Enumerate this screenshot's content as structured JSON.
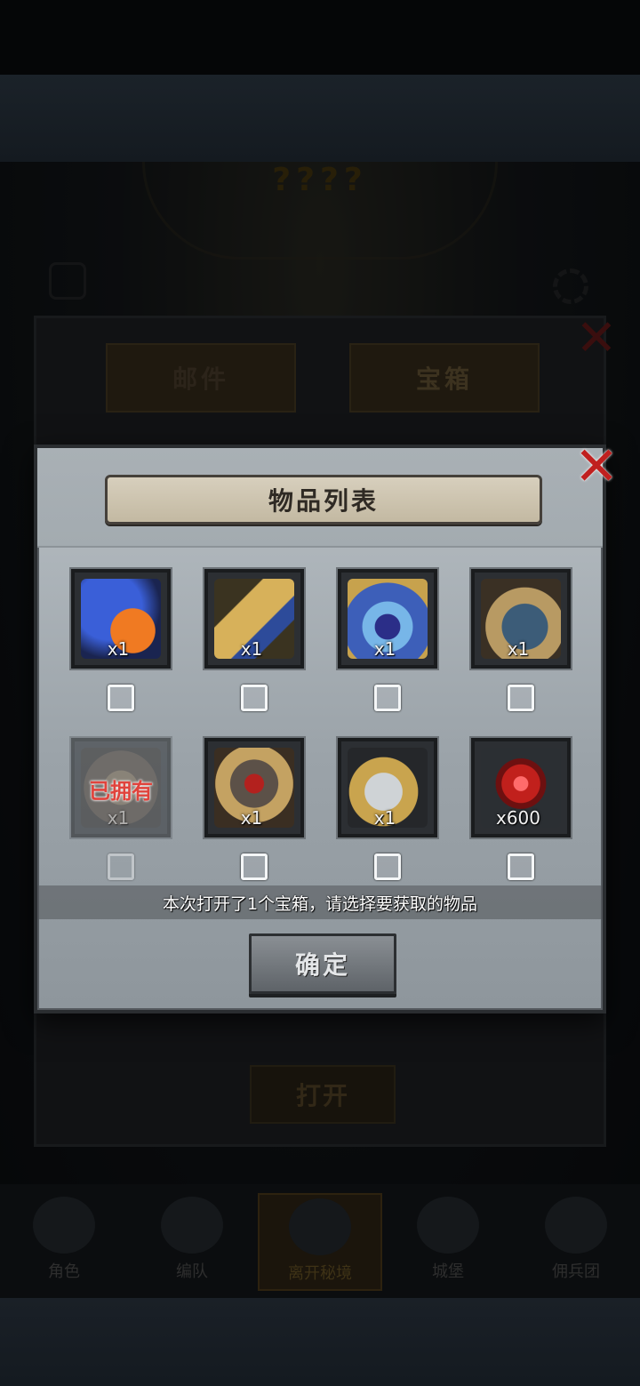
{
  "background": {
    "title_placeholder": "????",
    "mail_panel": {
      "tabs": [
        "邮件",
        "宝箱"
      ],
      "close_symbol": "✕",
      "open_button": "打开"
    },
    "nav": [
      "角色",
      "编队",
      "离开秘境",
      "城堡",
      "佣兵团"
    ]
  },
  "dialog": {
    "title": "物品列表",
    "close_symbol": "✕",
    "items": [
      {
        "icon": "flame-swirl-gem-icon",
        "qty": "x1",
        "owned": false
      },
      {
        "icon": "golden-shield-icon",
        "qty": "x1",
        "owned": false
      },
      {
        "icon": "crystal-tome-icon",
        "qty": "x1",
        "owned": false
      },
      {
        "icon": "winged-shield-icon",
        "qty": "x1",
        "owned": false
      },
      {
        "icon": "rune-disc-icon",
        "qty": "x1",
        "owned": true,
        "owned_label": "已拥有"
      },
      {
        "icon": "armored-knight-card-icon",
        "qty": "x1",
        "owned": false
      },
      {
        "icon": "moon-crest-shield-icon",
        "qty": "x1",
        "owned": false
      },
      {
        "icon": "red-crystal-icon",
        "qty": "x600",
        "owned": false
      }
    ],
    "notice": "本次打开了1个宝箱，请选择要获取的物品",
    "confirm_button": "确定"
  },
  "colors": {
    "close_red": "#c0201f",
    "owned_red": "#e0433c",
    "panel_gray": "#b7bec3"
  }
}
